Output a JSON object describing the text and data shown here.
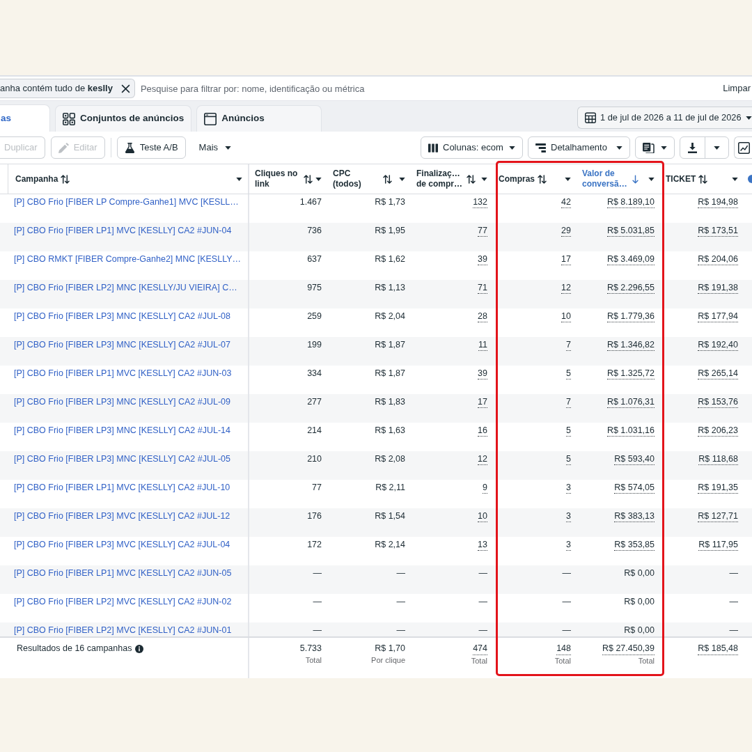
{
  "filter_bar": {
    "chip_text": "anha contém tudo de **keslly**",
    "search": {
      "placeholder": "Pesquise para filtrar por: nome, identificação ou métrica"
    },
    "clear_label": "Limpar"
  },
  "tabs": [
    {
      "kind": "campaigns",
      "label": "as",
      "selected": true
    },
    {
      "kind": "ad_sets",
      "label": "Conjuntos de anúncios",
      "selected": false
    },
    {
      "kind": "ads",
      "label": "Anúncios",
      "selected": false
    }
  ],
  "date_range": {
    "label": "1 de jul de 2026 a 11 de jul de 2026"
  },
  "toolbar": {
    "left_groups": [
      [
        {
          "kind": "duplicate",
          "label": "Duplicar",
          "disabled": true
        },
        {
          "kind": "edit",
          "label": "Editar",
          "disabled": true
        }
      ],
      [
        {
          "kind": "ab_test",
          "label": "Teste A/B",
          "disabled": false
        },
        {
          "kind": "more",
          "label": "Mais",
          "disabled": false
        }
      ]
    ],
    "right": [
      {
        "kind": "columns",
        "label": "Colunas: ecom"
      },
      {
        "kind": "breakdown",
        "label": "Detalhamento"
      },
      {
        "kind": "reports"
      },
      {
        "kind": "export"
      },
      {
        "kind": "chart"
      }
    ]
  },
  "table": {
    "columns": [
      {
        "label": "Campanha",
        "sorted": false,
        "dotted": false,
        "highlighted": false
      },
      {
        "label": "Cliques no link",
        "sorted": false,
        "dotted": false,
        "highlighted": false
      },
      {
        "label": "CPC (todos)",
        "sorted": false,
        "dotted": false,
        "highlighted": false
      },
      {
        "label": "Finalizaç… de compr…",
        "sorted": false,
        "dotted": true,
        "highlighted": false
      },
      {
        "label": "Compras",
        "sorted": false,
        "dotted": true,
        "highlighted": true
      },
      {
        "label": "Valor de conversã…",
        "sorted": true,
        "dotted": true,
        "highlighted": true
      },
      {
        "label": "TICKET",
        "sorted": false,
        "dotted": true,
        "highlighted": false
      }
    ],
    "rows": [
      {
        "name": "[P] CBO Frio [FIBER LP Compre-Ganhe1] MVC [KESLL…",
        "results": true,
        "cells": [
          "1.467",
          "R$ 1,73",
          "132",
          "42",
          "R$ 8.189,10",
          "R$ 194,98"
        ]
      },
      {
        "name": "[P] CBO Frio [FIBER LP1] MVC [KESLLY] CA2 #JUN-04",
        "results": true,
        "cells": [
          "736",
          "R$ 1,95",
          "77",
          "29",
          "R$ 5.031,85",
          "R$ 173,51"
        ]
      },
      {
        "name": "[P] CBO RMKT [FIBER Compre-Ganhe2] MNC [KESLLY…",
        "results": true,
        "cells": [
          "637",
          "R$ 1,62",
          "39",
          "17",
          "R$ 3.469,09",
          "R$ 204,06"
        ]
      },
      {
        "name": "[P] CBO Frio [FIBER LP2] MNC [KESLLY/JU VIEIRA] C…",
        "results": true,
        "cells": [
          "975",
          "R$ 1,13",
          "71",
          "12",
          "R$ 2.296,55",
          "R$ 191,38"
        ]
      },
      {
        "name": "[P] CBO Frio [FIBER LP3] MNC [KESLLY] CA2 #JUL-08",
        "results": true,
        "cells": [
          "259",
          "R$ 2,04",
          "28",
          "10",
          "R$ 1.779,36",
          "R$ 177,94"
        ]
      },
      {
        "name": "[P] CBO Frio [FIBER LP3] MNC [KESLLY] CA2 #JUL-07",
        "results": true,
        "cells": [
          "199",
          "R$ 1,87",
          "11",
          "7",
          "R$ 1.346,82",
          "R$ 192,40"
        ]
      },
      {
        "name": "[P] CBO Frio [FIBER LP1] MVC [KESLLY] CA2 #JUN-03",
        "results": true,
        "cells": [
          "334",
          "R$ 1,87",
          "39",
          "5",
          "R$ 1.325,72",
          "R$ 265,14"
        ]
      },
      {
        "name": "[P] CBO Frio [FIBER LP3] MNC [KESLLY] CA2 #JUL-09",
        "results": true,
        "cells": [
          "277",
          "R$ 1,83",
          "17",
          "7",
          "R$ 1.076,31",
          "R$ 153,76"
        ]
      },
      {
        "name": "[P] CBO Frio [FIBER LP3] MNC [KESLLY] CA2 #JUL-14",
        "results": true,
        "cells": [
          "214",
          "R$ 1,63",
          "16",
          "5",
          "R$ 1.031,16",
          "R$ 206,23"
        ]
      },
      {
        "name": "[P] CBO Frio [FIBER LP3] MNC [KESLLY] CA2 #JUL-05",
        "results": true,
        "cells": [
          "210",
          "R$ 2,08",
          "12",
          "5",
          "R$ 593,40",
          "R$ 118,68"
        ]
      },
      {
        "name": "[P] CBO Frio [FIBER LP1] MVC [KESLLY] CA2 #JUL-10",
        "results": true,
        "cells": [
          "77",
          "R$ 2,11",
          "9",
          "3",
          "R$ 574,05",
          "R$ 191,35"
        ]
      },
      {
        "name": "[P] CBO Frio [FIBER LP3] MVC [KESLLY] CA2 #JUL-12",
        "results": true,
        "cells": [
          "176",
          "R$ 1,54",
          "10",
          "3",
          "R$ 383,13",
          "R$ 127,71"
        ]
      },
      {
        "name": "[P] CBO Frio [FIBER LP3] MVC [KESLLY] CA2 #JUL-04",
        "results": true,
        "cells": [
          "172",
          "R$ 2,14",
          "13",
          "3",
          "R$ 353,85",
          "R$ 117,95"
        ]
      },
      {
        "name": "[P] CBO Frio [FIBER LP1] MVC [KESLLY] CA2 #JUN-05",
        "results": false,
        "cells": [
          "—",
          "—",
          "—",
          "—",
          "R$ 0,00",
          "—"
        ]
      },
      {
        "name": "[P] CBO Frio [FIBER LP2] MVC [KESLLY] CA2 #JUN-02",
        "results": false,
        "cells": [
          "—",
          "—",
          "—",
          "—",
          "R$ 0,00",
          "—"
        ]
      },
      {
        "name": "[P] CBO Frio [FIBER LP2] MVC [KESLLY] CA2 #JUN-01",
        "results": false,
        "cells": [
          "—",
          "—",
          "—",
          "—",
          "R$ 0,00",
          "—"
        ]
      }
    ]
  },
  "footer": {
    "label": "Resultados de 16 campanhas",
    "totals": [
      {
        "value": "5.733",
        "note": "Total"
      },
      {
        "value": "R$ 1,70",
        "note": "Por clique"
      },
      {
        "value": "474",
        "note": "Total"
      },
      {
        "value": "148",
        "note": "Total"
      },
      {
        "value": "R$ 27.450,39",
        "note": "Total"
      },
      {
        "value": "R$ 185,48"
      }
    ]
  }
}
